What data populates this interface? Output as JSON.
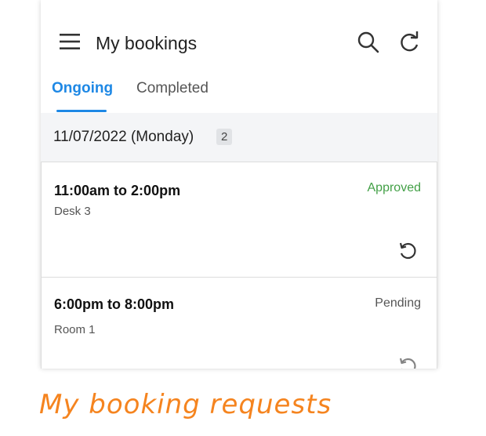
{
  "header": {
    "title": "My bookings"
  },
  "tabs": [
    {
      "label": "Ongoing",
      "active": true
    },
    {
      "label": "Completed",
      "active": false
    }
  ],
  "group": {
    "date": "11/07/2022 (Monday)",
    "count": "2"
  },
  "bookings": [
    {
      "time": "11:00am to 2:00pm",
      "place": "Desk 3",
      "status": "Approved"
    },
    {
      "time": "6:00pm to 8:00pm",
      "place": "Room 1",
      "status": "Pending"
    }
  ],
  "caption": "My booking requests",
  "colors": {
    "accent": "#1e88e5",
    "approved": "#43a047",
    "caption": "#f5841f"
  },
  "icons": [
    "menu-icon",
    "search-icon",
    "refresh-icon",
    "undo-icon"
  ]
}
